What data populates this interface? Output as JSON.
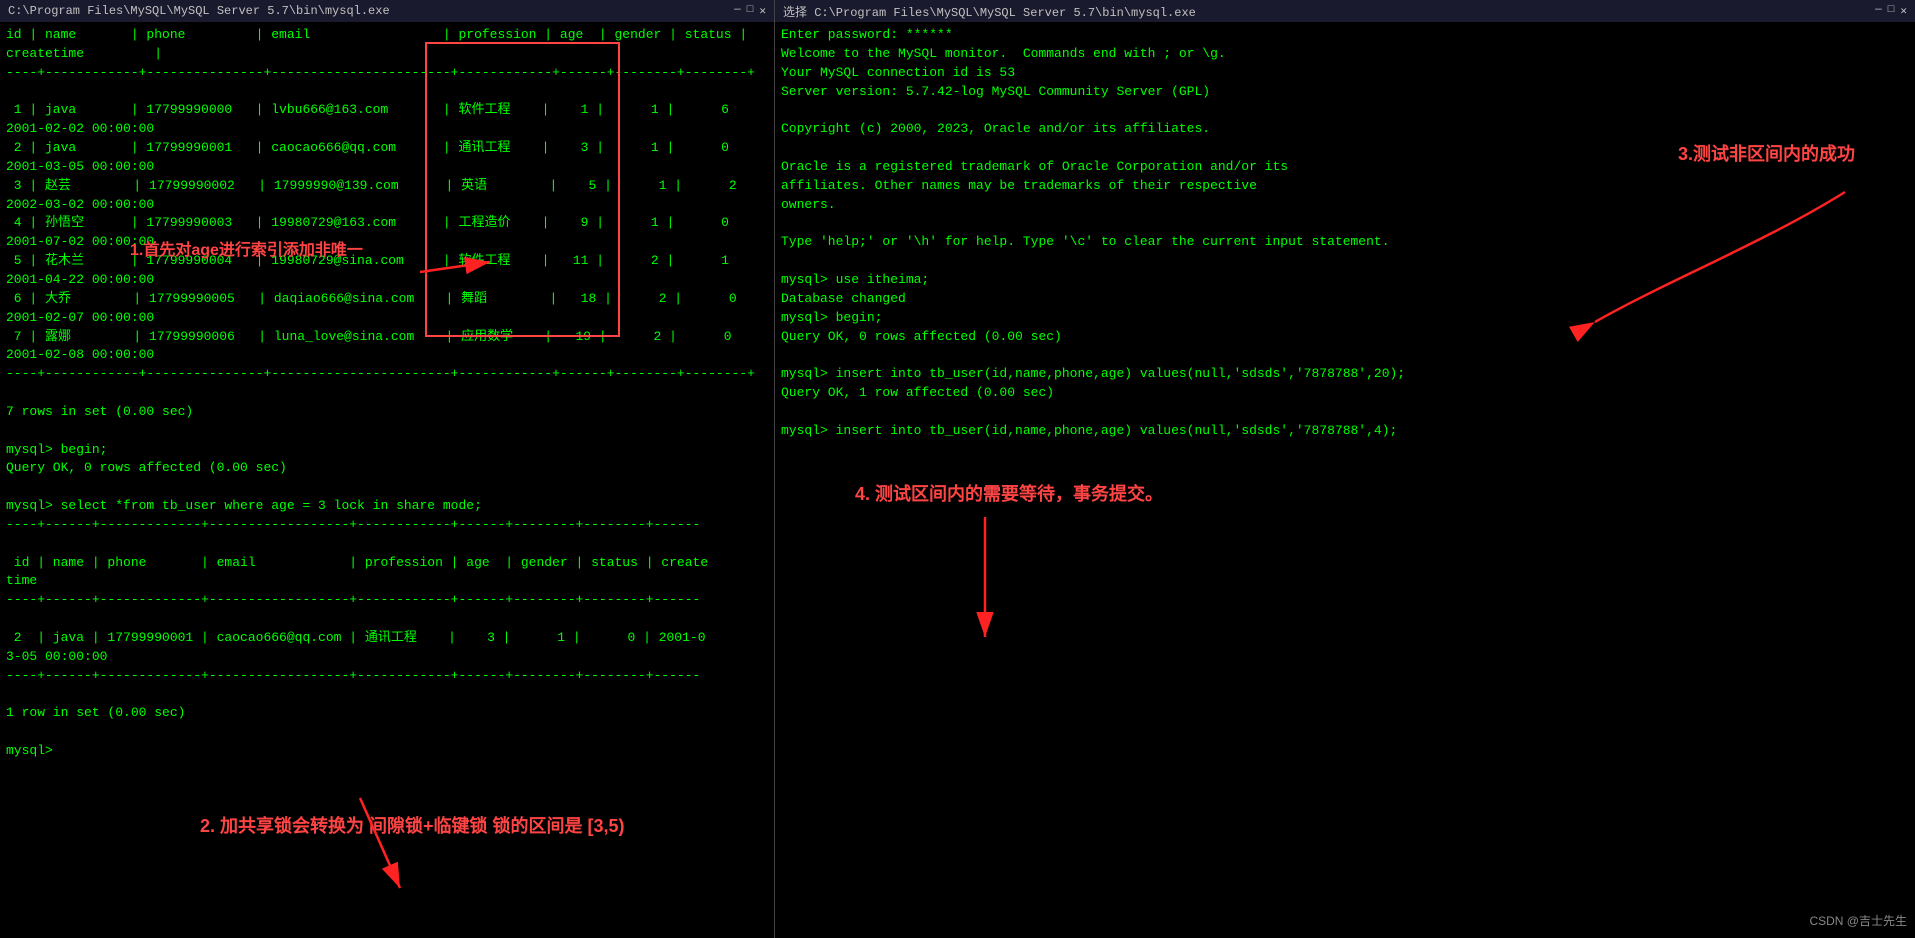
{
  "left_window": {
    "title": "C:\\Program Files\\MySQL\\MySQL Server 5.7\\bin\\mysql.exe",
    "controls": [
      "—",
      "□",
      "✕"
    ],
    "content_lines": [
      "id | name       | phone         | email                 | profession | age  | gender | status |",
      "createtime         |",
      "----+------------+---------------+-----------------------+------------+------+--------+--------+",
      "",
      " 1 | java       | 17799990000   | lvbu666@163.com       | 软件工程    |    1 |      1 |      6",
      "2001-02-02 00:00:00",
      " 2 | java       | 17799990001   | caocao666@qq.com      | 通讯工程    |    3 |      1 |      0",
      "2001-03-05 00:00:00",
      " 3 | 赵芸        | 17799990002   | 17999990@139.com      | 英语        |    5 |      1 |      2",
      "2002-03-02 00:00:00",
      " 4 | 孙悟空      | 17799990003   | 19980729@163.com      | 工程造价    |    9 |      1 |      0",
      "2001-07-02 00:00:00",
      " 5 | 花木兰      | 17799990004   | 19980729@sina.com     | 软件工程    |   11 |      2 |      1",
      "2001-04-22 00:00:00",
      " 6 | 大乔        | 17799990005   | daqiao666@sina.com    | 舞蹈        |   18 |      2 |      0",
      "2001-02-07 00:00:00",
      " 7 | 露娜        | 17799990006   | luna_love@sina.com    | 应用数学    |   19 |      2 |      0",
      "2001-02-08 00:00:00",
      "----+------------+---------------+-----------------------+------------+------+--------+--------+",
      "",
      "7 rows in set (0.00 sec)",
      "",
      "mysql> begin;",
      "Query OK, 0 rows affected (0.00 sec)",
      "",
      "mysql> select *from tb_user where age = 3 lock in share mode;",
      "----+------+-------------+------------------+------------+------+--------+--------+------",
      "",
      " id | name | phone       | email            | profession | age  | gender | status | create",
      "time",
      "----+------+-------------+------------------+------------+------+--------+--------+------",
      "",
      " 2  | java | 17799990001 | caocao666@qq.com | 通讯工程    |    3 |      1 |      0 | 2001-0",
      "3-05 00:00:00",
      "----+------+-------------+------------------+------------+------+--------+--------+------",
      "",
      "1 row in set (0.00 sec)",
      "",
      "mysql>"
    ]
  },
  "right_window": {
    "title": "选择 C:\\Program Files\\MySQL\\MySQL Server 5.7\\bin\\mysql.exe",
    "controls": [
      "—",
      "□",
      "✕"
    ],
    "content_lines": [
      "Enter password: ******",
      "Welcome to the MySQL monitor.  Commands end with ; or \\g.",
      "Your MySQL connection id is 53",
      "Server version: 5.7.42-log MySQL Community Server (GPL)",
      "",
      "Copyright (c) 2000, 2023, Oracle and/or its affiliates.",
      "",
      "Oracle is a registered trademark of Oracle Corporation and/or its",
      "affiliates. Other names may be trademarks of their respective",
      "owners.",
      "",
      "Type 'help;' or '\\h' for help. Type '\\c' to clear the current input statement.",
      "",
      "mysql> use itheima;",
      "Database changed",
      "mysql> begin;",
      "Query OK, 0 rows affected (0.00 sec)",
      "",
      "mysql> insert into tb_user(id,name,phone,age) values(null,'sdsds','7878788',20);",
      "Query OK, 1 row affected (0.00 sec)",
      "",
      "mysql> insert into tb_user(id,name,phone,age) values(null,'sdsds','7878788',4);"
    ]
  },
  "annotations": {
    "annotation1": "1.首先对age进行索引添加非唯一",
    "annotation2": "2. 加共享锁会转换为 间隙锁+临键锁 锁的区间是 [3,5)",
    "annotation3": "3.测试非区间内的成功",
    "annotation4": "4. 测试区间内的需要等待，事务提交。"
  },
  "watermark": "CSDN @吉士先生"
}
